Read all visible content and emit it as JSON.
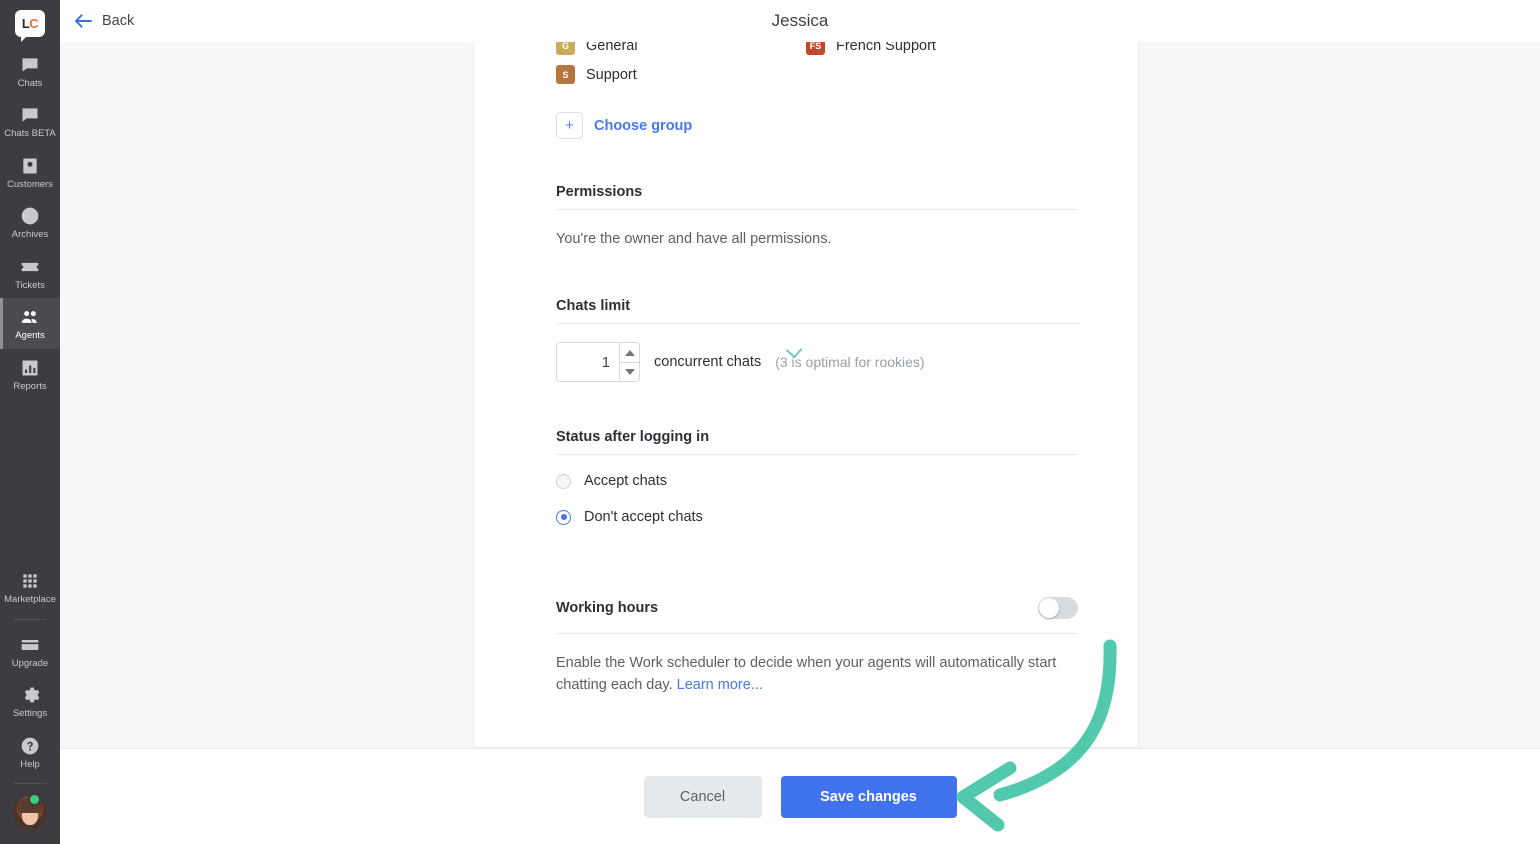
{
  "app": {
    "logo_left": "L",
    "logo_right": "C",
    "accent_blue": "#4273ee",
    "link_blue": "#4778ef",
    "arrow_green": "#52c9ac",
    "sidebar_bg": "#3c3c41"
  },
  "sidebar": {
    "items": [
      {
        "label": "Chats",
        "icon": "chat-bubble-icon",
        "active": false
      },
      {
        "label": "Chats BETA",
        "icon": "chat-bubble-icon",
        "active": false
      },
      {
        "label": "Customers",
        "icon": "id-card-icon",
        "active": false
      },
      {
        "label": "Archives",
        "icon": "clock-icon",
        "active": false
      },
      {
        "label": "Tickets",
        "icon": "ticket-icon",
        "active": false
      },
      {
        "label": "Agents",
        "icon": "people-icon",
        "active": true
      },
      {
        "label": "Reports",
        "icon": "bar-chart-icon",
        "active": false
      }
    ],
    "bottom_items": [
      {
        "label": "Marketplace",
        "icon": "grid-apps-icon"
      },
      {
        "label": "Upgrade",
        "icon": "credit-card-icon"
      },
      {
        "label": "Settings",
        "icon": "gear-icon"
      },
      {
        "label": "Help",
        "icon": "question-circle-icon"
      }
    ],
    "avatar": {
      "name": "avatar",
      "status": "online"
    }
  },
  "header": {
    "back_label": "Back",
    "title": "Jessica"
  },
  "groups": {
    "items": [
      {
        "initials": "G",
        "label": "General",
        "color": "#c8ad5b"
      },
      {
        "initials": "FS",
        "label": "French Support",
        "color": "#c2482c"
      },
      {
        "initials": "S",
        "label": "Support",
        "color": "#b5763f"
      }
    ],
    "choose_label": "Choose group",
    "plus_icon": "plus-icon"
  },
  "permissions": {
    "title": "Permissions",
    "text": "You're the owner and have all permissions."
  },
  "chats_limit": {
    "title": "Chats limit",
    "value": "1",
    "unit_label": "concurrent chats",
    "hint": "(3 is optimal for rookies)",
    "increment_icon": "chevron-up-icon",
    "decrement_icon": "chevron-down-icon"
  },
  "status_after_login": {
    "title": "Status after logging in",
    "options": [
      {
        "label": "Accept chats",
        "selected": false
      },
      {
        "label": "Don't accept chats",
        "selected": true
      }
    ]
  },
  "working_hours": {
    "title": "Working hours",
    "enabled": false,
    "description_before": "Enable the Work scheduler to decide when your agents will automatically start chatting each day. ",
    "learn_more": "Learn more..."
  },
  "footer": {
    "cancel_label": "Cancel",
    "save_label": "Save changes"
  },
  "annotation": {
    "type": "curved-arrow",
    "points_to": "save-changes-button",
    "color": "#52c9ac"
  }
}
